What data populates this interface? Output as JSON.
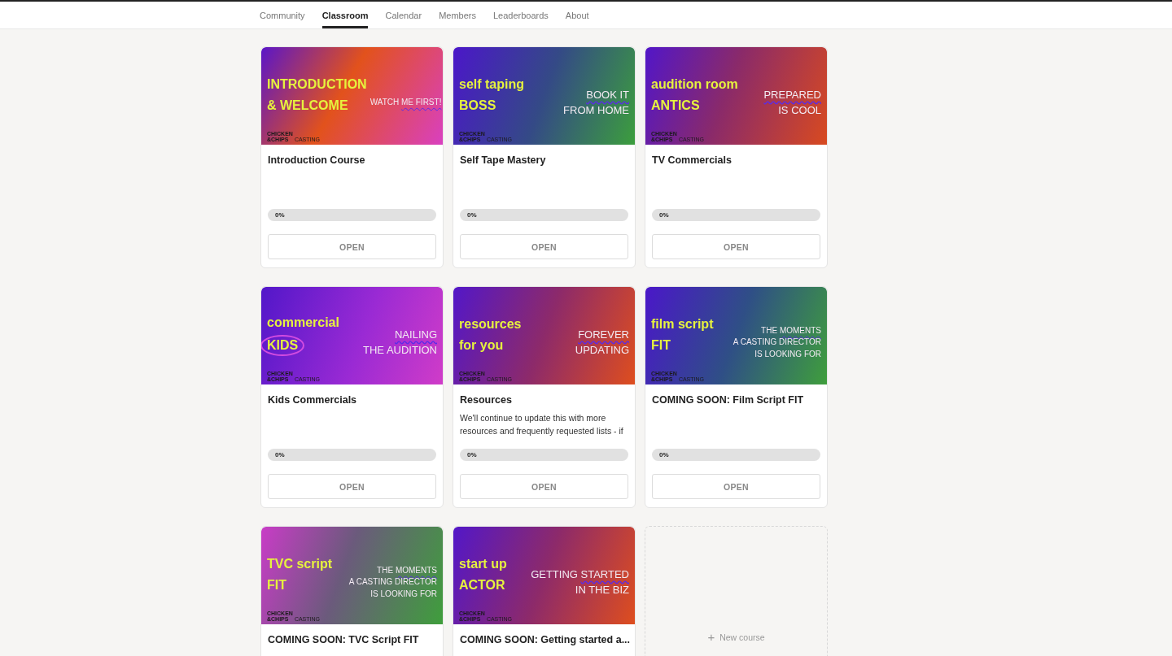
{
  "nav": {
    "tabs": [
      {
        "label": "Community",
        "selected": false
      },
      {
        "label": "Classroom",
        "selected": true
      },
      {
        "label": "Calendar",
        "selected": false
      },
      {
        "label": "Members",
        "selected": false
      },
      {
        "label": "Leaderboards",
        "selected": false
      },
      {
        "label": "About",
        "selected": false
      }
    ]
  },
  "courses": [
    {
      "cover": {
        "headline": [
          {
            "text": "INTRODUCTION",
            "circled": false
          },
          {
            "text": "& WELCOME",
            "circled": false
          }
        ],
        "tagline": [
          [
            {
              "text": "WATCH ",
              "underlined": false
            },
            {
              "text": "ME FIRST!",
              "underlined": true
            }
          ]
        ],
        "logo": [
          "CHICKEN",
          "&CHIPS",
          "CASTING"
        ]
      },
      "title": "Introduction Course",
      "progress": {
        "level": 0,
        "label": "0%"
      },
      "button": "OPEN"
    },
    {
      "cover": {
        "headline": [
          {
            "text": "self taping",
            "circled": false
          },
          {
            "text": "BOSS",
            "circled": false
          }
        ],
        "tagline": [
          [
            {
              "text": "BOOK IT",
              "underlined": true
            }
          ],
          [
            {
              "text": "FROM HOME",
              "underlined": false
            }
          ]
        ],
        "logo": [
          "CHICKEN",
          "&CHIPS",
          "CASTING"
        ]
      },
      "title": "Self Tape Mastery",
      "progress": {
        "level": 0,
        "label": "0%"
      },
      "button": "OPEN"
    },
    {
      "cover": {
        "headline": [
          {
            "text": "audition room",
            "circled": false
          },
          {
            "text": "ANTICS",
            "circled": false
          }
        ],
        "tagline": [
          [
            {
              "text": "PREPARED",
              "underlined": true
            }
          ],
          [
            {
              "text": "IS COOL",
              "underlined": false
            }
          ]
        ],
        "logo": [
          "CHICKEN",
          "&CHIPS",
          "CASTING"
        ]
      },
      "title": "TV Commercials",
      "progress": {
        "level": 0,
        "label": "0%"
      },
      "button": "OPEN"
    },
    {
      "cover": {
        "headline": [
          {
            "text": "commercial",
            "circled": false
          },
          {
            "text": "KIDS",
            "circled": true
          }
        ],
        "tagline": [
          [
            {
              "text": "NAILING",
              "underlined": true
            }
          ],
          [
            {
              "text": "THE  AUDITION",
              "underlined": false
            }
          ]
        ],
        "logo": [
          "CHICKEN",
          "&CHIPS",
          "CASTING"
        ]
      },
      "title": "Kids Commercials",
      "progress": {
        "level": 0,
        "label": "0%"
      },
      "button": "OPEN"
    },
    {
      "cover": {
        "headline": [
          {
            "text": "resources",
            "circled": false
          },
          {
            "text": "for you",
            "circled": false
          }
        ],
        "tagline": [
          [
            {
              "text": "FOREVER",
              "underlined": true
            }
          ],
          [
            {
              "text": "UPDATING",
              "underlined": false
            }
          ]
        ],
        "logo": [
          "CHICKEN",
          "&CHIPS",
          "CASTING"
        ]
      },
      "title": "Resources",
      "description": "We'll continue to update this with more resources and frequently requested lists - if",
      "progress": {
        "level": 0,
        "label": "0%"
      },
      "button": "OPEN"
    },
    {
      "cover": {
        "headline": [
          {
            "text": "film script",
            "circled": false
          },
          {
            "text": "FIT",
            "circled": false
          }
        ],
        "tagline": [
          [
            {
              "text": "THE ",
              "underlined": false
            },
            {
              "text": "MOMENTS",
              "underlined": true
            }
          ],
          [
            {
              "text": "A CASTING DIRECTOR",
              "underlined": false
            }
          ],
          [
            {
              "text": "IS LOOKING FOR",
              "underlined": false
            }
          ]
        ],
        "logo": [
          "CHICKEN",
          "&CHIPS",
          "CASTING"
        ]
      },
      "title": "COMING SOON: Film Script FIT",
      "progress": {
        "level": 0,
        "label": "0%"
      },
      "button": "OPEN"
    },
    {
      "cover": {
        "headline": [
          {
            "text": "TVC script",
            "circled": false
          },
          {
            "text": "FIT",
            "circled": false
          }
        ],
        "tagline": [
          [
            {
              "text": "THE ",
              "underlined": false
            },
            {
              "text": "MOMENTS",
              "underlined": true
            }
          ],
          [
            {
              "text": "A CASTING DIRECTOR",
              "underlined": false
            }
          ],
          [
            {
              "text": "IS LOOKING FOR",
              "underlined": false
            }
          ]
        ],
        "logo": [
          "CHICKEN",
          "&CHIPS",
          "CASTING"
        ]
      },
      "title": "COMING SOON: TVC Script FIT"
    },
    {
      "cover": {
        "headline": [
          {
            "text": "start up",
            "circled": false
          },
          {
            "text": "ACTOR",
            "circled": false
          }
        ],
        "tagline": [
          [
            {
              "text": "GETTING ",
              "underlined": false
            },
            {
              "text": "STARTED",
              "underlined": true
            }
          ],
          [
            {
              "text": "IN THE BIZ",
              "underlined": false
            }
          ]
        ],
        "logo": [
          "CHICKEN",
          "&CHIPS",
          "CASTING"
        ]
      },
      "title": "COMING SOON: Getting started a..."
    }
  ],
  "new_course": {
    "icon": "+",
    "label": "New course"
  }
}
